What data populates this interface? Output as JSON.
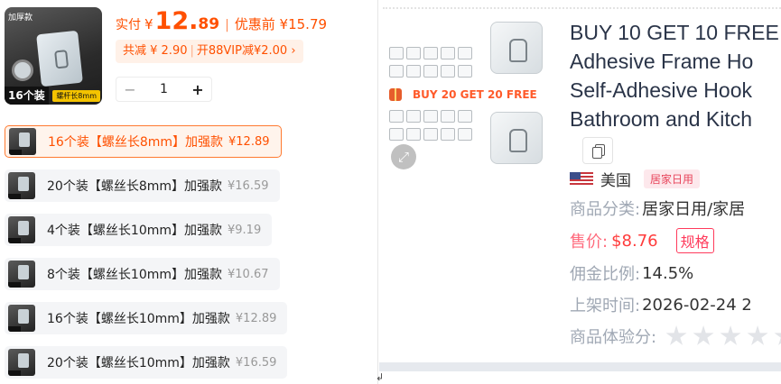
{
  "left": {
    "thumb": {
      "top_badge": "加厚款",
      "count": "16个装",
      "screw": "螺杆长8mm"
    },
    "price": {
      "label": "实付",
      "currency": "¥",
      "integer": "12.",
      "decimal": "89",
      "separator": "|",
      "before_label": "优惠前 ¥15.79"
    },
    "promo": {
      "discount": "共减 ¥ 2.90",
      "vip": "开88VIP减¥2.00 ›"
    },
    "quantity": {
      "minus": "−",
      "value": "1",
      "plus": "+"
    },
    "skus": [
      {
        "name": "16个装【螺丝长8mm】加强款",
        "price": "¥12.89",
        "active": true
      },
      {
        "name": "20个装【螺丝长8mm】加强款",
        "price": "¥16.59",
        "active": false
      },
      {
        "name": "4个装【螺丝长10mm】加强款",
        "price": "¥9.19",
        "active": false
      },
      {
        "name": "8个装【螺丝长10mm】加强款",
        "price": "¥10.67",
        "active": false
      },
      {
        "name": "16个装【螺丝长10mm】加强款",
        "price": "¥12.89",
        "active": false
      },
      {
        "name": "20个装【螺丝长10mm】加强款",
        "price": "¥16.59",
        "active": false
      }
    ]
  },
  "right": {
    "image": {
      "banner": "BUY 20 GET 20 FREE",
      "zoom_icon": "expand-icon"
    },
    "title_lines": [
      "BUY 10 GET 10 FREE",
      "Adhesive Frame Ho",
      "Self-Adhesive Hook",
      "Bathroom and Kitch"
    ],
    "copy_icon": "copy-icon",
    "origin": {
      "flag": "us-flag-icon",
      "country": "美国",
      "tag": "居家日用"
    },
    "category": {
      "label": "商品分类:",
      "value": "居家日用/家居"
    },
    "price": {
      "label": "售价:",
      "value": "$8.76",
      "spec_button": "规格"
    },
    "commission": {
      "label": "佣金比例:",
      "value": "14.5%"
    },
    "listed": {
      "label": "上架时间:",
      "value": "2026-02-24 2"
    },
    "experience": {
      "label": "商品体验分:",
      "stars": 5
    }
  },
  "colors": {
    "accent": "#ff5000",
    "price_red": "#ff3b3b",
    "label_gray": "#a0a8b4",
    "title": "#2a3448"
  }
}
